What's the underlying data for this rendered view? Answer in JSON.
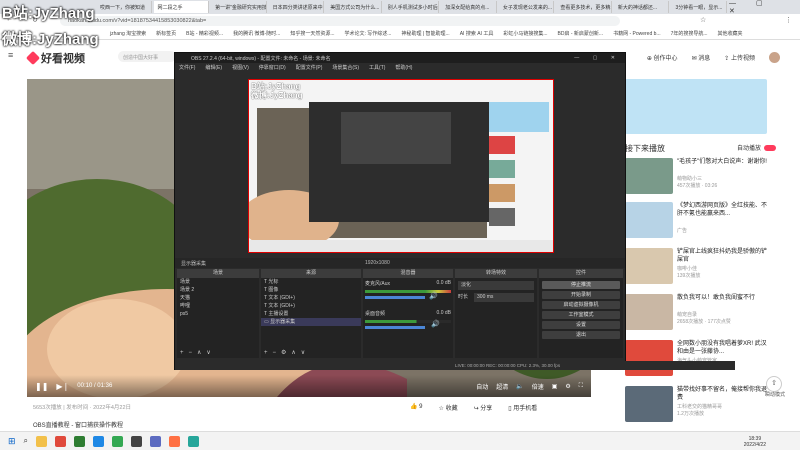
{
  "browser": {
    "tabs": [
      "哎西一下，你被知道",
      "网二段之手",
      "第一讲\"金融研究实用技术\"",
      "日本四分类讲述原来中国数...",
      "美国方式公司为什么...",
      "别人手机测试多小时后...",
      "加深女配给真的点...",
      "女子发现老公发来的...",
      "查看更多技术，更多精...",
      "新大的神话都还...",
      "3分钟看一眼，显示..."
    ],
    "url": "haokan.baidu.com/v?vid=18187534415853030822&tab=",
    "bookmarks": [
      "jzhang 淘宝搜索",
      "新标签页",
      "B站 - 精彩视频...",
      "我的腾讯 微博-随时...",
      "知乎搜一天然资源...",
      "学术论文: 写作综述...",
      "神秘助理 | 智能助理...",
      "AI 搜索 AI 工具",
      "彩虹小马链接搜集...",
      "BD启 - 新启蒙创新...",
      "书籍网 - Powered b...",
      "7年的搜搜导航...",
      "其他收藏夹"
    ]
  },
  "watermark": {
    "line1": "B站:JyZhang",
    "line2": "微博:JyZhang"
  },
  "site": {
    "logo": "好看视频",
    "search_placeholder": "创造中国大好事",
    "creator_center": "创作中心",
    "message": "消息",
    "upload": "上传视频"
  },
  "player": {
    "time": "00:10 / 01:36",
    "controls": [
      "自动",
      "超清",
      "倍速"
    ]
  },
  "video_meta": "5653次播放 | 发布时间 · 2022年4月22日",
  "actions": [
    {
      "icon": "like-icon",
      "label": "9"
    },
    {
      "icon": "star-icon",
      "label": "收藏"
    },
    {
      "icon": "share-icon",
      "label": "分享"
    },
    {
      "icon": "phone-icon",
      "label": "用手机看"
    }
  ],
  "below_title": "OBS直播教程 - 窗口捕获操作教程",
  "obs": {
    "title": "OBS 27.2.4 (64-bit, windows) - 配置文件: 未命名 - 场景: 未命名",
    "menu": [
      "文件(F)",
      "编辑(E)",
      "视图(V)",
      "停靠窗口(D)",
      "配置文件(P)",
      "场景集合(S)",
      "工具(T)",
      "帮助(H)"
    ],
    "source_bar": "显示器采集",
    "scenes_header": "场景",
    "scenes": [
      "场景",
      "场景 2",
      "天猫",
      "哔哩",
      "ps5"
    ],
    "sources_header": "来源",
    "sources": [
      "光标",
      "图像",
      "文本 (GDI+)",
      "文本 (GDI+)",
      "主播设置",
      "显示器采集"
    ],
    "mixer_header": "混音器",
    "mixer": [
      {
        "name": "麦克风/Aux",
        "db": "0.0 dB"
      },
      {
        "name": "桌面音频",
        "db": "0.0 dB"
      }
    ],
    "transitions_header": "转场特效",
    "transition": "淡化",
    "duration_label": "时长",
    "duration_value": "300 ms",
    "controls_header": "控件",
    "controls": [
      "停止推流",
      "开始录制",
      "启动虚拟摄像机",
      "工作室模式",
      "设置",
      "退出"
    ],
    "status": "LIVE: 00:00:00   REC: 00:00:00   CPU: 2.3%, 30.00 fps",
    "resolution_bar": "1920x1080"
  },
  "sidebar": {
    "section_title": "接下来播放",
    "autoplay_label": "自动播放",
    "items": [
      {
        "title": "\"毛孩子\"们憋对大白说声：谢谢你!",
        "author": "萌物助小三",
        "views": "457次播放 · 03:26"
      },
      {
        "title": "《梦幻西游网页版》全红技能、不肝不氪也能赢来西...",
        "author": "广告",
        "views": ""
      },
      {
        "title": "铲屎官上线疯狂抖奶我是骄傲的铲屎官",
        "author": "咖啡小佳",
        "views": "139次播放"
      },
      {
        "title": "散负我可以！敢负我闺蜜不行",
        "author": "萌宠自录",
        "views": "2658次播放 · 177次点赞"
      },
      {
        "title": "全网数小朋没有我唱着萝XR! 武汉和由是一张藤协...",
        "author": "海气头小萌宠管家",
        "views": "1.7万次播放 · 433次点赞"
      },
      {
        "title": "猫带找好事不留名，俺接帮你我退费",
        "author": "工科老交的猫精哥哥",
        "views": "1.2万次播放"
      }
    ]
  },
  "float_button": {
    "icon": "home-mode-icon",
    "label": "瞬动模式"
  },
  "taskbar": {
    "time": "18:39",
    "date": "2022/4/22"
  }
}
